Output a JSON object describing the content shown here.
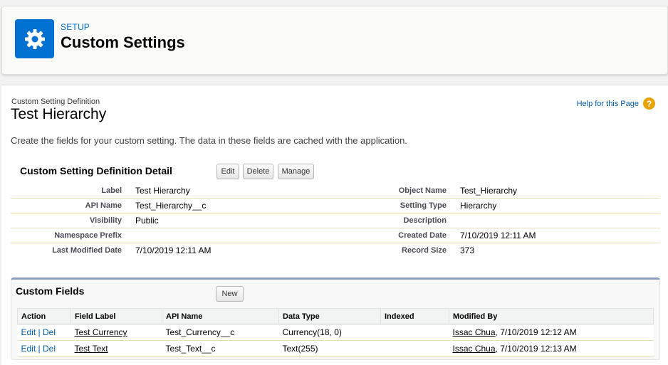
{
  "header": {
    "kicker": "SETUP",
    "title": "Custom Settings",
    "icon": "gear-icon",
    "icon_color": "#0070d2"
  },
  "page": {
    "subtitle": "Custom Setting Definition",
    "title": "Test Hierarchy",
    "help_link": "Help for this Page",
    "help_icon": "?",
    "description": "Create the fields for your custom setting. The data in these fields are cached with the application."
  },
  "detail": {
    "title": "Custom Setting Definition Detail",
    "buttons": {
      "edit": "Edit",
      "delete": "Delete",
      "manage": "Manage"
    },
    "rows": [
      {
        "l1": "Label",
        "v1": "Test Hierarchy",
        "l2": "Object Name",
        "v2": "Test_Hierarchy"
      },
      {
        "l1": "API Name",
        "v1": "Test_Hierarchy__c",
        "l2": "Setting Type",
        "v2": "Hierarchy"
      },
      {
        "l1": "Visibility",
        "v1": "Public",
        "l2": "Description",
        "v2": ""
      },
      {
        "l1": "Namespace Prefix",
        "v1": "",
        "l2": "Created Date",
        "v2": "7/10/2019 12:11 AM"
      },
      {
        "l1": "Last Modified Date",
        "v1": "7/10/2019 12:11 AM",
        "l2": "Record Size",
        "v2": "373"
      }
    ]
  },
  "custom_fields": {
    "title": "Custom Fields",
    "new_button": "New",
    "columns": [
      "Action",
      "Field Label",
      "API Name",
      "Data Type",
      "Indexed",
      "Modified By"
    ],
    "rows": [
      {
        "edit": "Edit",
        "sep": "|",
        "del": "Del",
        "label": "Test Currency",
        "api": "Test_Currency__c",
        "type": "Currency(18, 0)",
        "indexed": "",
        "user": "Issac Chua",
        "date": ", 7/10/2019 12:12 AM"
      },
      {
        "edit": "Edit",
        "sep": "|",
        "del": "Del",
        "label": "Test Text",
        "api": "Test_Text__c",
        "type": "Text(255)",
        "indexed": "",
        "user": "Issac Chua",
        "date": ", 7/10/2019 12:13 AM"
      }
    ]
  }
}
